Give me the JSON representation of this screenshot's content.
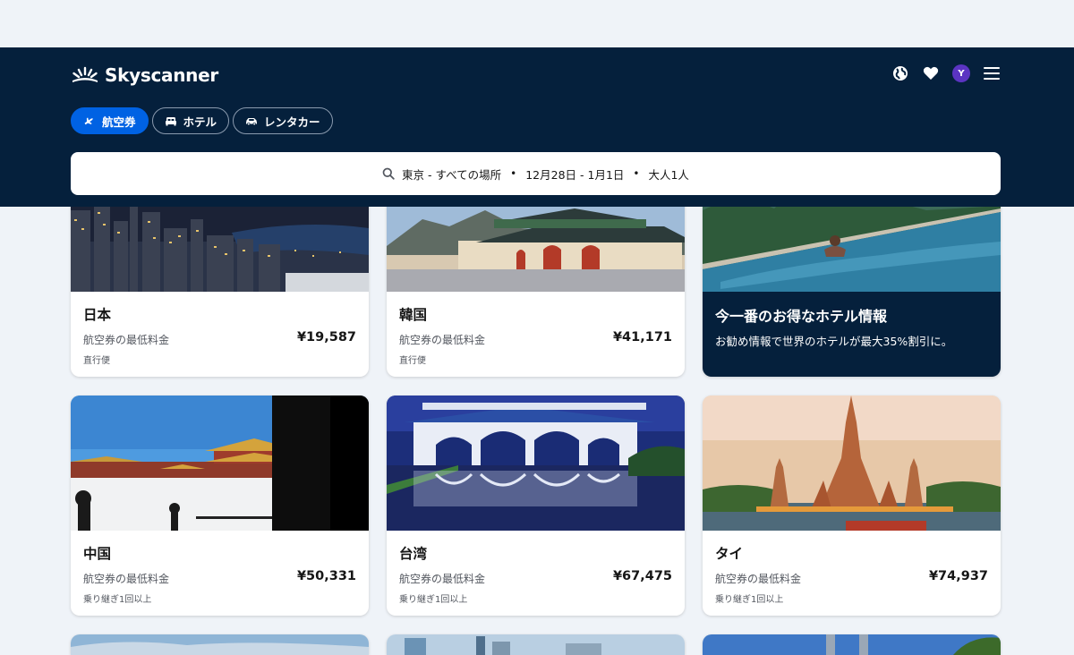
{
  "brand": {
    "name": "Skyscanner"
  },
  "header": {
    "avatar_initial": "Y",
    "icons": [
      "globe-icon",
      "heart-icon",
      "menu-icon"
    ],
    "tabs": [
      {
        "label": "航空券",
        "icon": "plane-icon",
        "active": true
      },
      {
        "label": "ホテル",
        "icon": "bed-icon",
        "active": false
      },
      {
        "label": "レンタカー",
        "icon": "car-icon",
        "active": false
      }
    ]
  },
  "search": {
    "origin_dest": "東京 - すべての場所",
    "dates": "12月28日 - 1月1日",
    "travellers": "大人1人",
    "separator": "•"
  },
  "destinations": [
    {
      "name": "日本",
      "price_label": "航空券の最低料金",
      "price": "¥19,587",
      "stops": "直行便"
    },
    {
      "name": "韓国",
      "price_label": "航空券の最低料金",
      "price": "¥41,171",
      "stops": "直行便"
    },
    {
      "name": "中国",
      "price_label": "航空券の最低料金",
      "price": "¥50,331",
      "stops": "乗り継ぎ1回以上"
    },
    {
      "name": "台湾",
      "price_label": "航空券の最低料金",
      "price": "¥67,475",
      "stops": "乗り継ぎ1回以上"
    },
    {
      "name": "タイ",
      "price_label": "航空券の最低料金",
      "price": "¥74,937",
      "stops": "乗り継ぎ1回以上"
    }
  ],
  "promo": {
    "title": "今一番のお得なホテル情報",
    "description": "お勧め情報で世界のホテルが最大35%割引に。"
  },
  "colors": {
    "header_bg": "#05203c",
    "accent": "#0062e3",
    "page_bg": "#eff3f8",
    "avatar": "#5b34c2"
  }
}
